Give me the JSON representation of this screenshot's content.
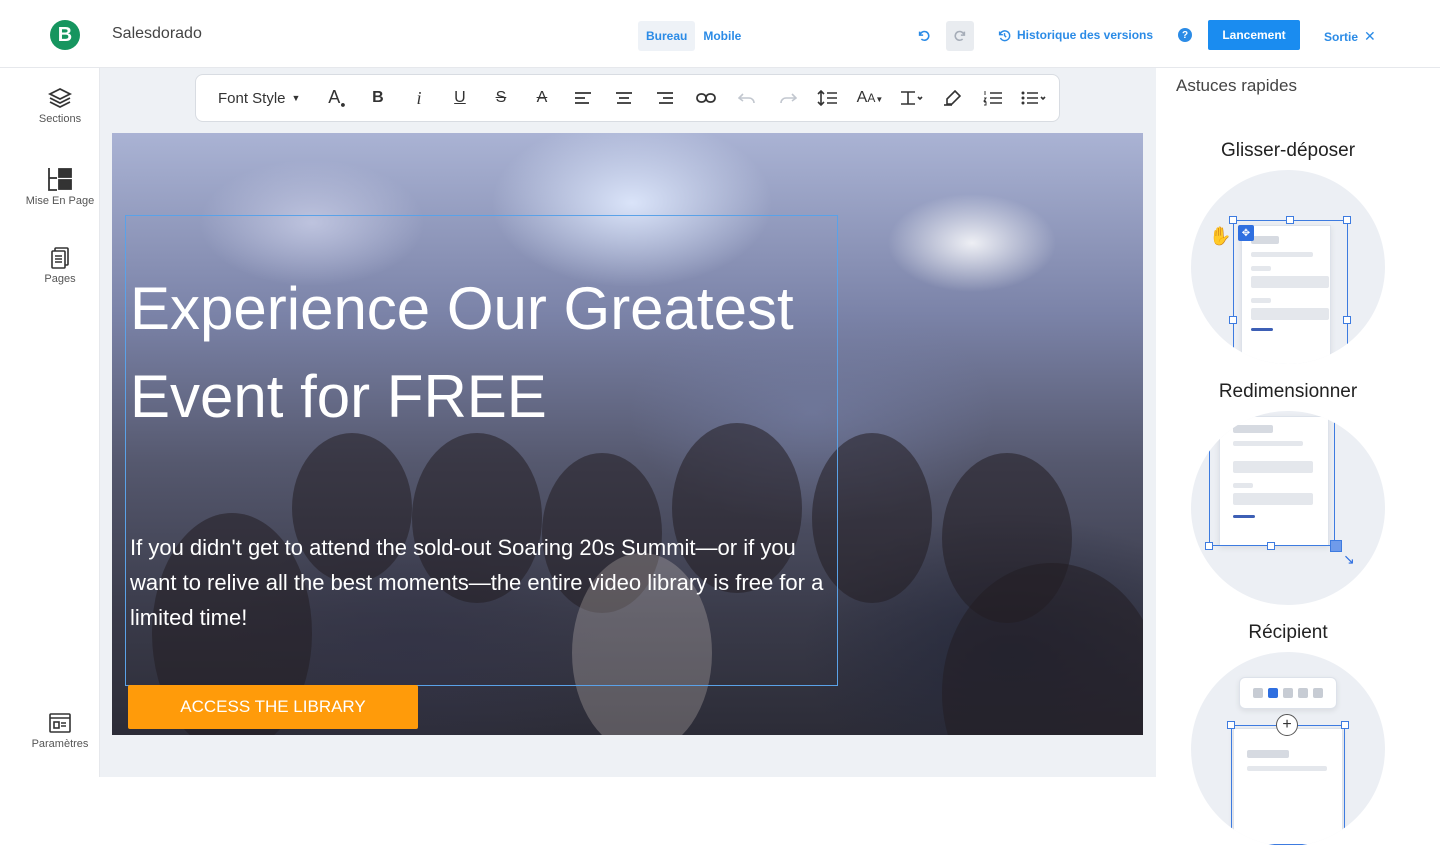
{
  "header": {
    "logo_letter": "B",
    "app_name": "Salesdorado",
    "views": [
      "Bureau",
      "Mobile"
    ],
    "history_label": "Historique des versions",
    "help_label": "?",
    "launch_label": "Lancement",
    "exit_label": "Sortie"
  },
  "sidebar": {
    "items": [
      {
        "label": "Sections",
        "icon": "layers-icon"
      },
      {
        "label": "Mise En Page",
        "icon": "layout-icon"
      },
      {
        "label": "Pages",
        "icon": "pages-icon"
      },
      {
        "label": "Paramètres",
        "icon": "settings-window-icon"
      }
    ]
  },
  "toolbar": {
    "font_style_label": "Font Style"
  },
  "hero": {
    "title": "Experience Our Greatest Event for FREE",
    "text": "If you didn't get to attend the sold-out Soaring 20s Summit—or if you want to relive all the best moments—the entire video library is free for a limited time!",
    "cta_label": "ACCESS THE LIBRARY"
  },
  "tips": {
    "panel_title": "Astuces rapides",
    "items": [
      "Glisser-déposer",
      "Redimensionner",
      "Récipient"
    ]
  },
  "colors": {
    "accent": "#1a8cf0",
    "brand_green": "#16955f",
    "cta_orange": "#ff9b0a"
  }
}
